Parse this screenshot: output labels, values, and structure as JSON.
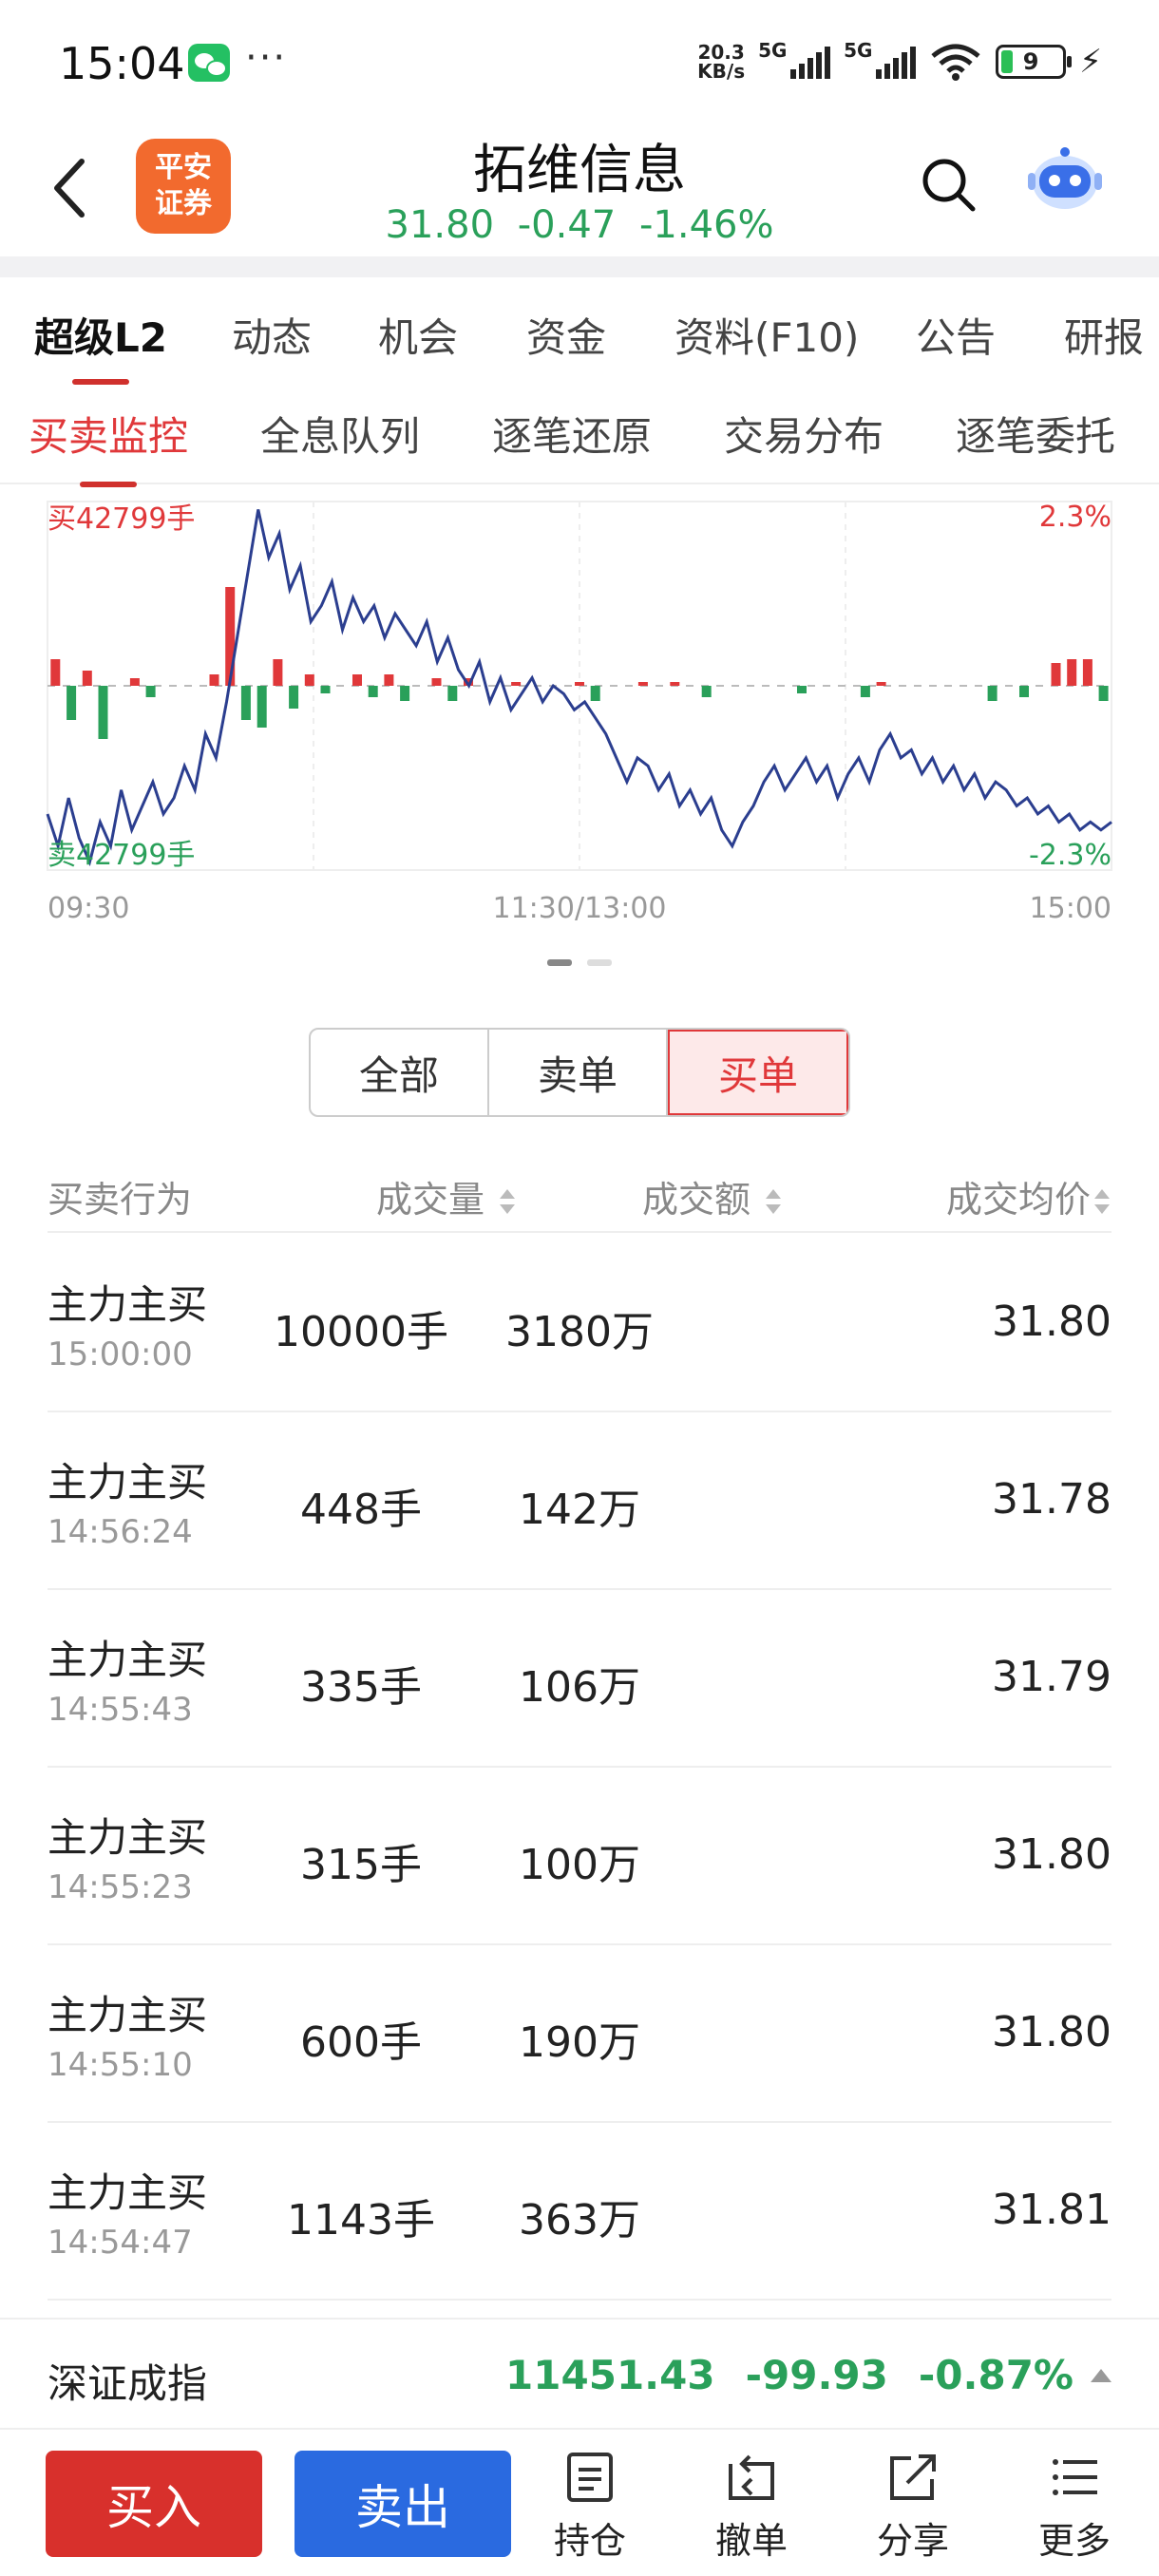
{
  "status_bar": {
    "time": "15:04",
    "dots": "···",
    "net_speed_top": "20.3",
    "net_speed_bottom": "KB/s",
    "sig1_label": "5G",
    "sig2_label": "5G",
    "battery": "9",
    "icons": [
      "wechat-icon",
      "signal-icon",
      "wifi-icon",
      "battery-icon",
      "charging-icon"
    ]
  },
  "header": {
    "logo_line1": "平安",
    "logo_line2": "证券",
    "stock_name": "拓维信息",
    "price": "31.80",
    "change": "-0.47",
    "change_pct": "-1.46%",
    "quote_color": "#2aa05a",
    "icons": [
      "back-arrow-icon",
      "search-icon",
      "robot-assistant-icon"
    ]
  },
  "tabs_primary": [
    "超级L2",
    "动态",
    "机会",
    "资金",
    "资料(F10)",
    "公告",
    "研报"
  ],
  "tabs_secondary": [
    "买卖监控",
    "全息队列",
    "逐笔还原",
    "交易分布",
    "逐笔委托"
  ],
  "chart_data": {
    "type": "line",
    "buy_label": "买42799手",
    "sell_label": "卖42799手",
    "upper_pct": "2.3%",
    "lower_pct": "-2.3%",
    "x_ticks": [
      "09:30",
      "11:30/13:00",
      "15:00"
    ],
    "ylim": [
      -2.3,
      2.3
    ],
    "price_line": [
      -1.6,
      -2.0,
      -1.4,
      -1.9,
      -2.2,
      -1.7,
      -2.0,
      -1.3,
      -1.8,
      -1.5,
      -1.2,
      -1.6,
      -1.4,
      -1.0,
      -1.3,
      -0.6,
      -0.9,
      -0.2,
      0.6,
      1.4,
      2.2,
      1.6,
      1.9,
      1.2,
      1.5,
      0.8,
      1.0,
      1.3,
      0.7,
      1.1,
      0.8,
      1.0,
      0.6,
      0.9,
      0.7,
      0.5,
      0.8,
      0.3,
      0.6,
      0.2,
      0.0,
      0.3,
      -0.2,
      0.1,
      -0.3,
      -0.1,
      0.1,
      -0.2,
      0.0,
      -0.1,
      -0.3,
      -0.2,
      -0.4,
      -0.6,
      -0.9,
      -1.2,
      -0.9,
      -1.0,
      -1.3,
      -1.1,
      -1.5,
      -1.3,
      -1.6,
      -1.4,
      -1.8,
      -2.0,
      -1.7,
      -1.5,
      -1.2,
      -1.0,
      -1.3,
      -1.1,
      -0.9,
      -1.2,
      -1.0,
      -1.4,
      -1.1,
      -0.9,
      -1.2,
      -0.8,
      -0.6,
      -0.9,
      -0.8,
      -1.1,
      -0.9,
      -1.2,
      -1.0,
      -1.3,
      -1.1,
      -1.4,
      -1.2,
      -1.3,
      -1.5,
      -1.4,
      -1.6,
      -1.5,
      -1.7,
      -1.6,
      -1.8,
      -1.7,
      -1.8,
      -1.7
    ],
    "volume_bars": [
      0.7,
      -0.9,
      0.4,
      -1.4,
      0.0,
      0.2,
      -0.3,
      0.0,
      0.0,
      0.0,
      0.3,
      2.6,
      -0.9,
      -1.1,
      0.7,
      -0.6,
      0.3,
      -0.2,
      0.0,
      0.3,
      -0.3,
      0.3,
      -0.4,
      0.0,
      0.2,
      -0.4,
      0.2,
      0.0,
      0.0,
      0.1,
      0.0,
      0.0,
      0.0,
      0.1,
      -0.4,
      0.0,
      0.0,
      0.1,
      0.0,
      0.1,
      0.0,
      -0.3,
      0.0,
      0.0,
      0.0,
      0.0,
      0.0,
      -0.2,
      0.0,
      0.0,
      0.0,
      -0.3,
      0.1,
      0.0,
      0.0,
      0.0,
      0.0,
      0.0,
      0.0,
      -0.4,
      0.0,
      -0.3,
      0.0,
      0.6,
      0.7,
      0.7,
      -0.4
    ]
  },
  "segment": {
    "options": [
      "全部",
      "卖单",
      "买单"
    ],
    "selected": "买单"
  },
  "table": {
    "headers": [
      "买卖行为",
      "成交量",
      "成交额",
      "成交均价"
    ],
    "rows": [
      {
        "action": "主力主买",
        "time": "15:00:00",
        "volume": "10000手",
        "amount": "3180万",
        "avg": "31.80"
      },
      {
        "action": "主力主买",
        "time": "14:56:24",
        "volume": "448手",
        "amount": "142万",
        "avg": "31.78"
      },
      {
        "action": "主力主买",
        "time": "14:55:43",
        "volume": "335手",
        "amount": "106万",
        "avg": "31.79"
      },
      {
        "action": "主力主买",
        "time": "14:55:23",
        "volume": "315手",
        "amount": "100万",
        "avg": "31.80"
      },
      {
        "action": "主力主买",
        "time": "14:55:10",
        "volume": "600手",
        "amount": "190万",
        "avg": "31.80"
      },
      {
        "action": "主力主买",
        "time": "14:54:47",
        "volume": "1143手",
        "amount": "363万",
        "avg": "31.81"
      }
    ]
  },
  "index_bar": {
    "name": "深证成指",
    "value": "11451.43",
    "change": "-99.93",
    "change_pct": "-0.87%"
  },
  "toolbar": {
    "buy": "买入",
    "sell": "卖出",
    "holdings": "持仓",
    "cancel": "撤单",
    "share": "分享",
    "more": "更多"
  },
  "colors": {
    "up": "#e0383a",
    "down": "#2aa05a",
    "buy_button": "#d8302c",
    "sell_button": "#2a6ae0",
    "line": "#2b3e8f"
  }
}
